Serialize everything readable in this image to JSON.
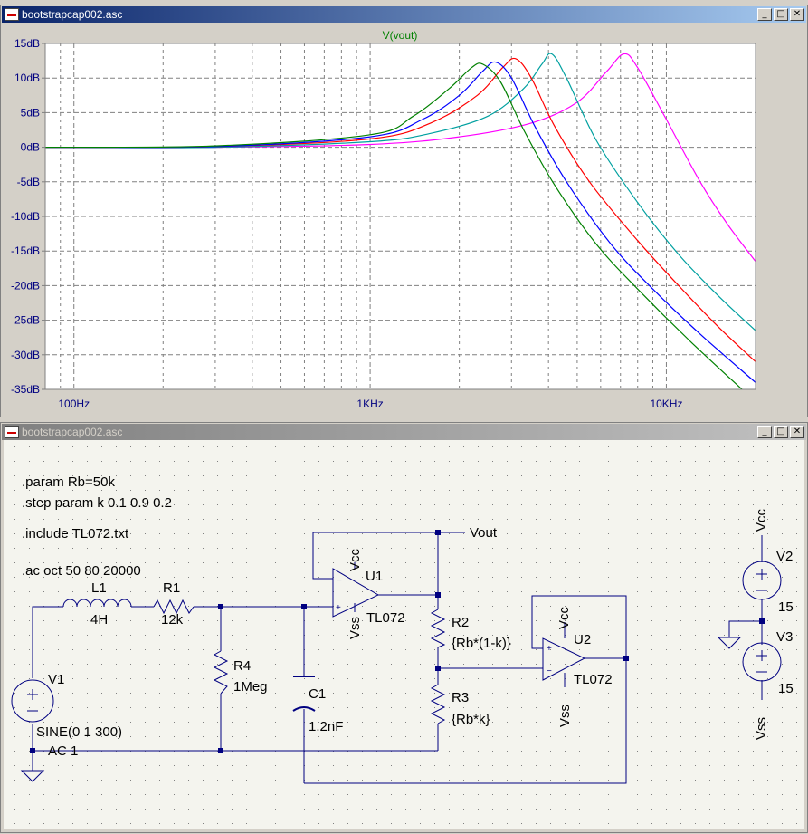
{
  "plot_window": {
    "title": "bootstrapcap002.asc",
    "trace_label": "V(vout)",
    "buttons": [
      "_",
      "□",
      "✕"
    ]
  },
  "schematic_window": {
    "title": "bootstrapcap002.asc",
    "buttons": [
      "_",
      "□",
      "✕"
    ],
    "directives": [
      ".param Rb=50k",
      ".step param k 0.1 0.9 0.2",
      ".include TL072.txt",
      ".ac oct 50 80 20000"
    ],
    "labels": {
      "L1": "L1",
      "L1_val": "4H",
      "R1": "R1",
      "R1_val": "12k",
      "R4": "R4",
      "R4_val": "1Meg",
      "C1": "C1",
      "C1_val": "1.2nF",
      "R2": "R2",
      "R2_val": "{Rb*(1-k)}",
      "R3": "R3",
      "R3_val": "{Rb*k}",
      "U1": "U1",
      "U1_model": "TL072",
      "U2": "U2",
      "U2_model": "TL072",
      "V1": "V1",
      "V1_val1": "SINE(0 1 300)",
      "V1_val2": "AC 1",
      "V2": "V2",
      "V2_val": "15",
      "V3": "V3",
      "V3_val": "15",
      "vout": "Vout",
      "vcc": "Vcc",
      "vss": "Vss"
    }
  },
  "colors": {
    "grid": "#808080",
    "plot_bg": "#ffffff",
    "wire": "#000080",
    "label_green": "#008000"
  },
  "chart_data": {
    "type": "line",
    "title": "V(vout)",
    "xlabel": "",
    "ylabel": "",
    "xscale": "log",
    "xlim": [
      80,
      20000
    ],
    "ylim": [
      -35,
      15
    ],
    "x_ticks": [
      {
        "v": 100,
        "label": "100Hz"
      },
      {
        "v": 1000,
        "label": "1KHz"
      },
      {
        "v": 10000,
        "label": "10KHz"
      }
    ],
    "y_ticks": [
      15,
      10,
      5,
      0,
      -5,
      -10,
      -15,
      -20,
      -25,
      -30,
      -35
    ],
    "y_tick_labels": [
      "15dB",
      "10dB",
      "5dB",
      "0dB",
      "-5dB",
      "-10dB",
      "-15dB",
      "-20dB",
      "-25dB",
      "-30dB",
      "-35dB"
    ],
    "grid": true,
    "series": [
      {
        "color": "#ff00ff",
        "points": [
          [
            80,
            0
          ],
          [
            300,
            0
          ],
          [
            1000,
            0.4
          ],
          [
            2000,
            1.5
          ],
          [
            3500,
            3.5
          ],
          [
            5000,
            6.5
          ],
          [
            6300,
            11
          ],
          [
            7200,
            13.5
          ],
          [
            8000,
            11.5
          ],
          [
            10000,
            4
          ],
          [
            13000,
            -5
          ],
          [
            16000,
            -11
          ],
          [
            20000,
            -16.5
          ]
        ]
      },
      {
        "color": "#00a0a0",
        "points": [
          [
            80,
            0
          ],
          [
            300,
            0
          ],
          [
            1000,
            0.8
          ],
          [
            1600,
            2
          ],
          [
            2500,
            4.5
          ],
          [
            3300,
            8.5
          ],
          [
            3800,
            12
          ],
          [
            4100,
            13.5
          ],
          [
            4600,
            10
          ],
          [
            5800,
            1
          ],
          [
            8000,
            -8
          ],
          [
            11000,
            -15.5
          ],
          [
            15000,
            -21.5
          ],
          [
            20000,
            -26.5
          ]
        ]
      },
      {
        "color": "#ff0000",
        "points": [
          [
            80,
            0
          ],
          [
            300,
            0.1
          ],
          [
            1000,
            1.2
          ],
          [
            1600,
            3.5
          ],
          [
            2300,
            7.5
          ],
          [
            2800,
            11.5
          ],
          [
            3100,
            12.8
          ],
          [
            3500,
            10
          ],
          [
            4200,
            3
          ],
          [
            5500,
            -5
          ],
          [
            8000,
            -13.5
          ],
          [
            11000,
            -20
          ],
          [
            15000,
            -26
          ],
          [
            20000,
            -31
          ]
        ]
      },
      {
        "color": "#0000ff",
        "points": [
          [
            80,
            0
          ],
          [
            300,
            0.1
          ],
          [
            1000,
            1.5
          ],
          [
            1500,
            4
          ],
          [
            2000,
            7.5
          ],
          [
            2400,
            11
          ],
          [
            2650,
            12.3
          ],
          [
            3000,
            10
          ],
          [
            3600,
            3
          ],
          [
            4600,
            -5
          ],
          [
            6500,
            -14
          ],
          [
            9000,
            -20.5
          ],
          [
            13000,
            -27
          ],
          [
            20000,
            -34
          ]
        ]
      },
      {
        "color": "#008000",
        "points": [
          [
            80,
            0
          ],
          [
            300,
            0.2
          ],
          [
            1000,
            1.8
          ],
          [
            1400,
            4.5
          ],
          [
            1850,
            8.5
          ],
          [
            2200,
            11.5
          ],
          [
            2400,
            12
          ],
          [
            2750,
            9.5
          ],
          [
            3300,
            2.5
          ],
          [
            4200,
            -5.5
          ],
          [
            5800,
            -14
          ],
          [
            8000,
            -20.5
          ],
          [
            12000,
            -28
          ],
          [
            18000,
            -35
          ]
        ]
      }
    ]
  }
}
